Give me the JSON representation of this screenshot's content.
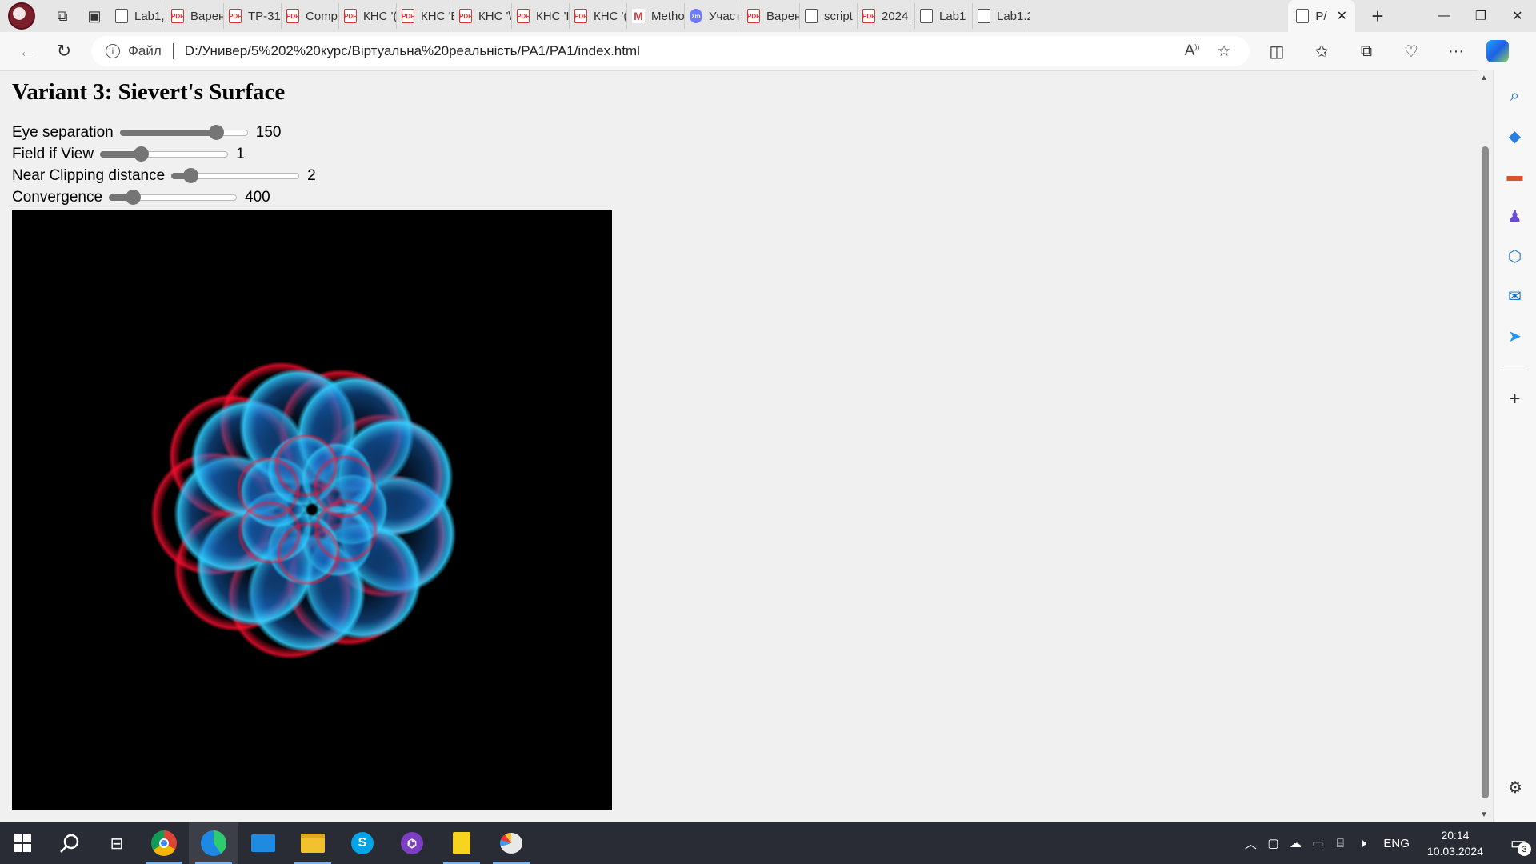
{
  "browser": {
    "tabs": [
      {
        "title": "Lab1,",
        "icon": "doc"
      },
      {
        "title": "Варен",
        "icon": "pdf"
      },
      {
        "title": "ТР-31",
        "icon": "pdf"
      },
      {
        "title": "Comp",
        "icon": "pdf"
      },
      {
        "title": "КНС '(",
        "icon": "pdf"
      },
      {
        "title": "КНС 'Е",
        "icon": "pdf"
      },
      {
        "title": "КНС '\\",
        "icon": "pdf"
      },
      {
        "title": "КНС 'I",
        "icon": "pdf"
      },
      {
        "title": "КНС '(",
        "icon": "pdf"
      },
      {
        "title": "Metho",
        "icon": "mail"
      },
      {
        "title": "Участ",
        "icon": "zm"
      },
      {
        "title": "Варен",
        "icon": "pdf"
      },
      {
        "title": "script",
        "icon": "doc"
      },
      {
        "title": "2024_",
        "icon": "pdf"
      },
      {
        "title": "Lab1",
        "icon": "doc"
      },
      {
        "title": "Lab1.2",
        "icon": "doc"
      }
    ],
    "active_tab": {
      "title": "P/",
      "icon": "doc"
    },
    "pdf_icon_text": "PDF",
    "zm_icon_text": "zm",
    "mail_icon_text": "M",
    "address": {
      "file_label": "Файл",
      "url": "D:/Универ/5%202%20курс/Віртуальна%20реальність/PA1/PA1/index.html"
    }
  },
  "page": {
    "title": "Variant 3: Sievert's Surface",
    "sliders": [
      {
        "label": "Eye separation",
        "value": "150",
        "fraction": 0.75
      },
      {
        "label": "Field if View",
        "value": "1",
        "fraction": 0.32
      },
      {
        "label": "Near Clipping distance",
        "value": "2",
        "fraction": 0.15
      },
      {
        "label": "Convergence",
        "value": "400",
        "fraction": 0.19
      }
    ],
    "canvas": {
      "background": "#000000",
      "render": "anaglyph Sievert's surface (red/cyan)"
    }
  },
  "taskbar": {
    "apps": [
      "start",
      "search",
      "task-view",
      "chrome",
      "edge",
      "mail",
      "file-explorer",
      "skype",
      "github-desktop",
      "notes",
      "paint"
    ],
    "language": "ENG",
    "time": "20:14",
    "date": "10.03.2024",
    "notifications": "3"
  }
}
